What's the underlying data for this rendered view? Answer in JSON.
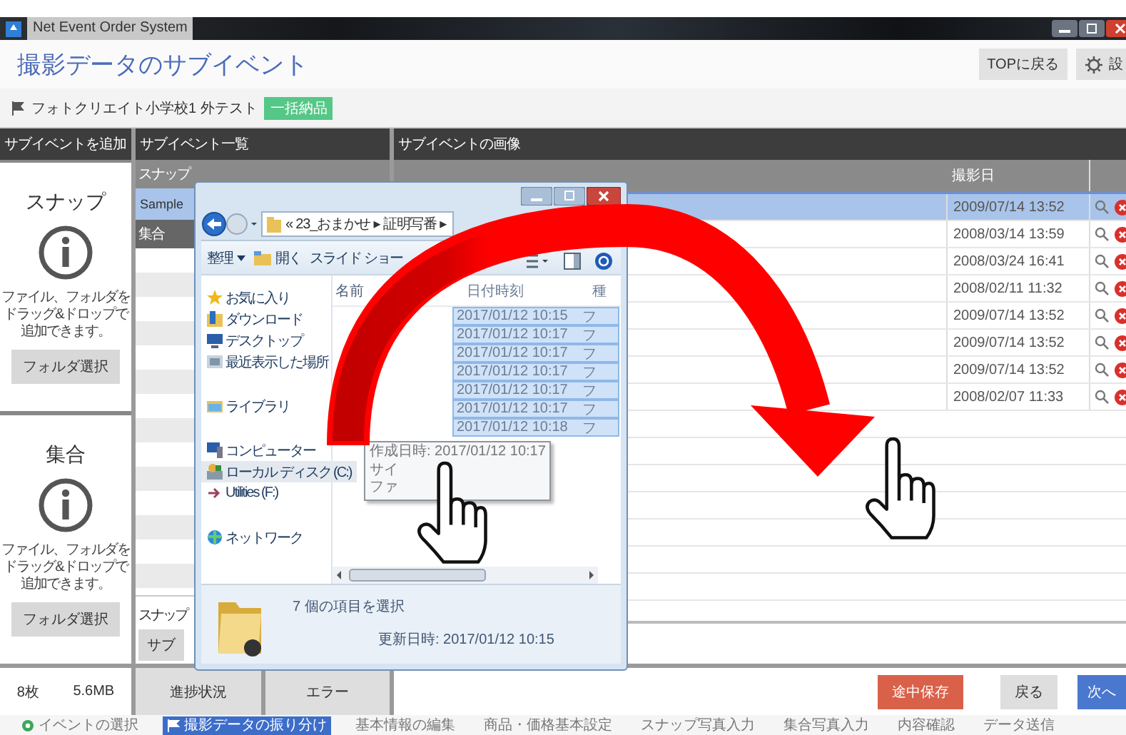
{
  "window": {
    "title": "Net Event Order System"
  },
  "header": {
    "title": "撮影データのサブイベント",
    "buttons": [
      {
        "label": "TOPに戻る",
        "kind": "plain"
      },
      {
        "label": "設",
        "kind": "settings"
      }
    ]
  },
  "breadcrumb": {
    "text": "フォトクリエイト小学校1 外テスト",
    "badge": "一括納品"
  },
  "add_panel": {
    "heading": "サブイベントを追加",
    "cards": [
      {
        "title": "スナップ",
        "hint": [
          "ファイル、フォルダを",
          "ドラッグ&ドロップで",
          "追加できます。"
        ],
        "button": "フォルダ選択"
      },
      {
        "title": "集合",
        "hint": [
          "ファイル、フォルダを",
          "ドラッグ&ドロップで",
          "追加できます。"
        ],
        "button": "フォルダ選択"
      }
    ],
    "count": "8枚",
    "size": "5.6MB"
  },
  "list_panel": {
    "heading": "サブイベント一覧",
    "groups": [
      {
        "label": "スナップ",
        "items": [
          {
            "label": "Sample",
            "selected": true
          }
        ]
      },
      {
        "label": "集合"
      }
    ],
    "footer_label": "スナップ",
    "footer_button": "サブ",
    "buttons": [
      "進捗状況",
      "エラー"
    ]
  },
  "images_panel": {
    "heading": "サブイベントの画像",
    "columns": [
      "撮影日"
    ],
    "rows": [
      {
        "date": "2009/07/14 13:52",
        "selected": true
      },
      {
        "date": "2008/03/14 13:59",
        "selected": false
      },
      {
        "date": "2008/03/24 16:41",
        "selected": false
      },
      {
        "date": "2008/02/11 11:32",
        "selected": false
      },
      {
        "date": "2009/07/14 13:52",
        "selected": false
      },
      {
        "date": "2009/07/14 13:52",
        "selected": false
      },
      {
        "date": "2009/07/14 13:52",
        "selected": false
      },
      {
        "date": "2008/02/07 11:33",
        "selected": false
      }
    ]
  },
  "actions": [
    {
      "label": "途中保存",
      "kind": "save"
    },
    {
      "label": "戻る",
      "kind": "back"
    },
    {
      "label": "次へ",
      "kind": "next"
    }
  ],
  "steps": [
    {
      "label": "イベントの選択",
      "selected": false,
      "done": true
    },
    {
      "label": "撮影データの振り分け",
      "selected": true,
      "done": false
    },
    {
      "label": "基本情報の編集",
      "selected": false,
      "done": false
    },
    {
      "label": "商品・価格基本設定",
      "selected": false,
      "done": false
    },
    {
      "label": "スナップ写真入力",
      "selected": false,
      "done": false
    },
    {
      "label": "集合写真入力",
      "selected": false,
      "done": false
    },
    {
      "label": "内容確認",
      "selected": false,
      "done": false
    },
    {
      "label": "データ送信",
      "selected": false,
      "done": false
    }
  ],
  "explorer": {
    "path": "« 23_おまかせ ▸ 証明写番 ▸",
    "toolbar": [
      "整理",
      "開く",
      "スライド ショー"
    ],
    "nav": [
      {
        "label": "お気に入り",
        "kind": "star",
        "selected": false,
        "children": [
          {
            "label": "ダウンロード",
            "kind": "download",
            "selected": false
          },
          {
            "label": "デスクトップ",
            "kind": "desktop",
            "selected": false
          },
          {
            "label": "最近表示した場所",
            "kind": "recent",
            "selected": false
          }
        ]
      },
      {
        "label": "ライブラリ",
        "kind": "library",
        "selected": false
      },
      {
        "label": "コンピューター",
        "kind": "computer",
        "selected": false,
        "children": [
          {
            "label": "ローカル ディスク (C:)",
            "kind": "disk",
            "selected": true
          },
          {
            "label": "Utilities (F:)",
            "kind": "drive",
            "selected": false
          }
        ]
      },
      {
        "label": "ネットワーク",
        "kind": "network",
        "selected": false
      }
    ],
    "columns": [
      "名前",
      "日付時刻",
      "種"
    ],
    "files": [
      {
        "date": "2017/01/12 10:15",
        "type": "フ",
        "selected": true
      },
      {
        "date": "2017/01/12 10:17",
        "type": "フ",
        "selected": true
      },
      {
        "date": "2017/01/12 10:17",
        "type": "フ",
        "selected": true
      },
      {
        "date": "2017/01/12 10:17",
        "type": "フ",
        "selected": true
      },
      {
        "date": "2017/01/12 10:17",
        "type": "フ",
        "selected": true
      },
      {
        "date": "2017/01/12 10:17",
        "type": "フ",
        "selected": true
      },
      {
        "date": "2017/01/12 10:18",
        "type": "フ",
        "selected": true
      }
    ],
    "tooltip": [
      "作成日時: 2017/01/12 10:17",
      "サイ",
      "ファ"
    ],
    "status": "7 個の項目を選択",
    "modified": "更新日時: 2017/01/12 10:15"
  }
}
